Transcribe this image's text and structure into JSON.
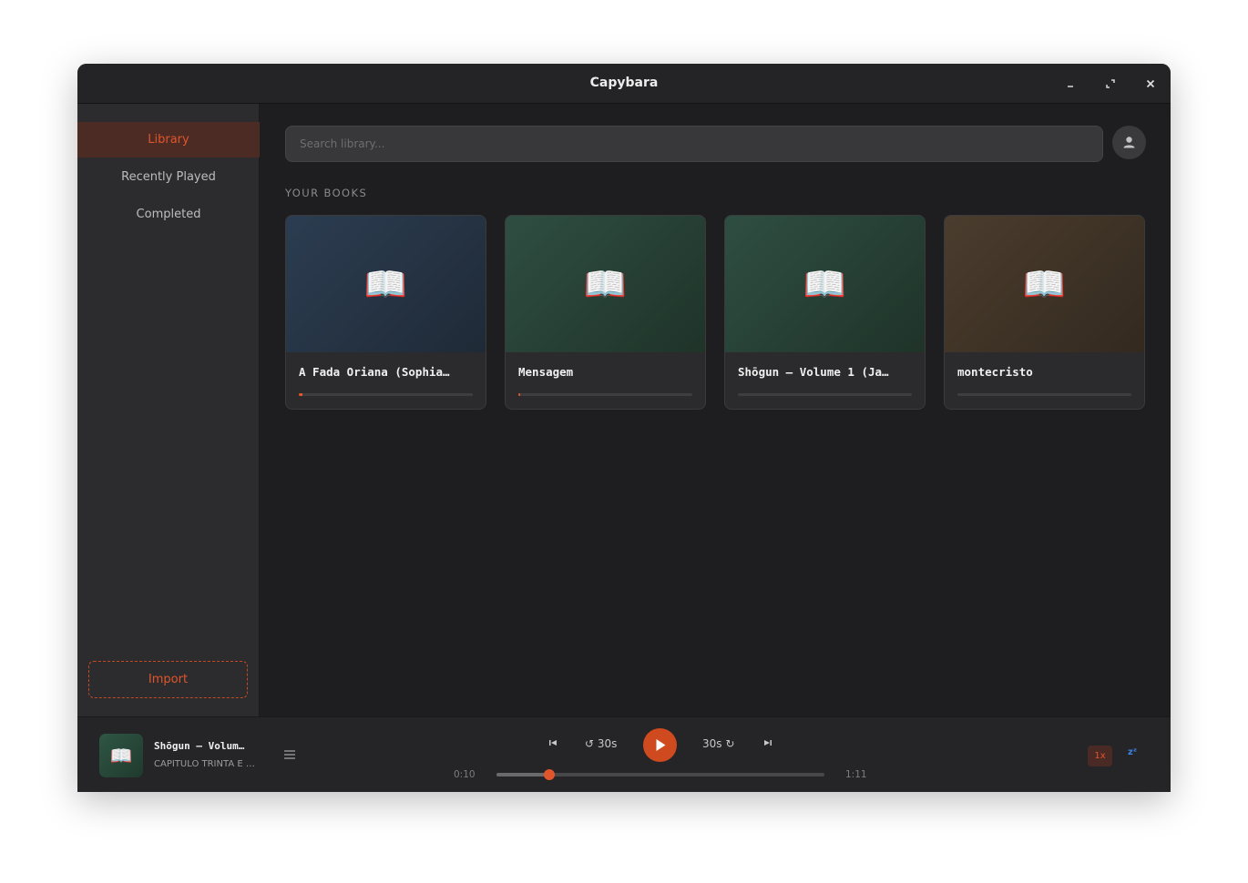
{
  "window": {
    "title": "Capybara"
  },
  "sidebar": {
    "items": [
      {
        "label": "Library",
        "active": true
      },
      {
        "label": "Recently Played",
        "active": false
      },
      {
        "label": "Completed",
        "active": false
      }
    ],
    "import_label": "Import"
  },
  "search": {
    "placeholder": "Search library..."
  },
  "section_label": "YOUR BOOKS",
  "books": [
    {
      "title": "A Fada Oriana (Sophia…",
      "progress": 0.02,
      "cover_from": "#2c3d51",
      "cover_to": "#1f2a37",
      "icon": "open-book-icon"
    },
    {
      "title": "Mensagem",
      "progress": 0.01,
      "cover_from": "#2f4e42",
      "cover_to": "#1f3329",
      "icon": "open-book-icon"
    },
    {
      "title": "Shōgun — Volume 1 (Ja…",
      "progress": 0.0,
      "cover_from": "#2f4e42",
      "cover_to": "#1f3329",
      "icon": "open-book-icon"
    },
    {
      "title": "montecristo",
      "progress": 0.0,
      "cover_from": "#4b3d2e",
      "cover_to": "#33291f",
      "icon": "open-book-icon"
    }
  ],
  "player": {
    "title": "Shōgun — Volum…",
    "chapter": "CAPÍTULO TRINTA E …",
    "skip_back_label": "30s",
    "skip_forward_label": "30s",
    "elapsed": "0:10",
    "duration": "1:11",
    "progress": 0.16,
    "speed_label": "1x",
    "sleep_label": "zᶻ"
  },
  "colors": {
    "accent": "#e0552b",
    "background": "#1e1e20",
    "sidebar": "#2c2c2e"
  }
}
